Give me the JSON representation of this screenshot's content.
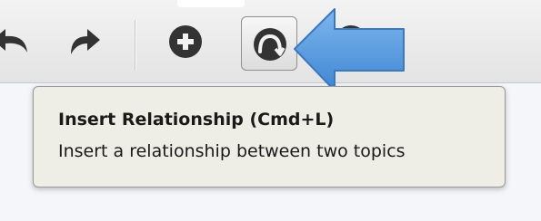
{
  "toolbar": {
    "buttons": [
      {
        "icon": "undo-icon"
      },
      {
        "icon": "redo-icon"
      },
      {
        "icon": "add-topic-icon"
      },
      {
        "icon": "relationship-icon",
        "state": "hovered"
      },
      {
        "icon": "next-tool-icon"
      }
    ]
  },
  "tooltip": {
    "title": "Insert Relationship (Cmd+L)",
    "description": "Insert a relationship between two topics"
  },
  "pointer_arrow": {
    "icon": "pointer-arrow-icon",
    "color": "#4a90d9"
  },
  "colors": {
    "toolbar_bg": "#e8e8e8",
    "icon": "#333333",
    "tooltip_bg": "#eeeee6",
    "canvas_bg": "#f4f6fa"
  }
}
